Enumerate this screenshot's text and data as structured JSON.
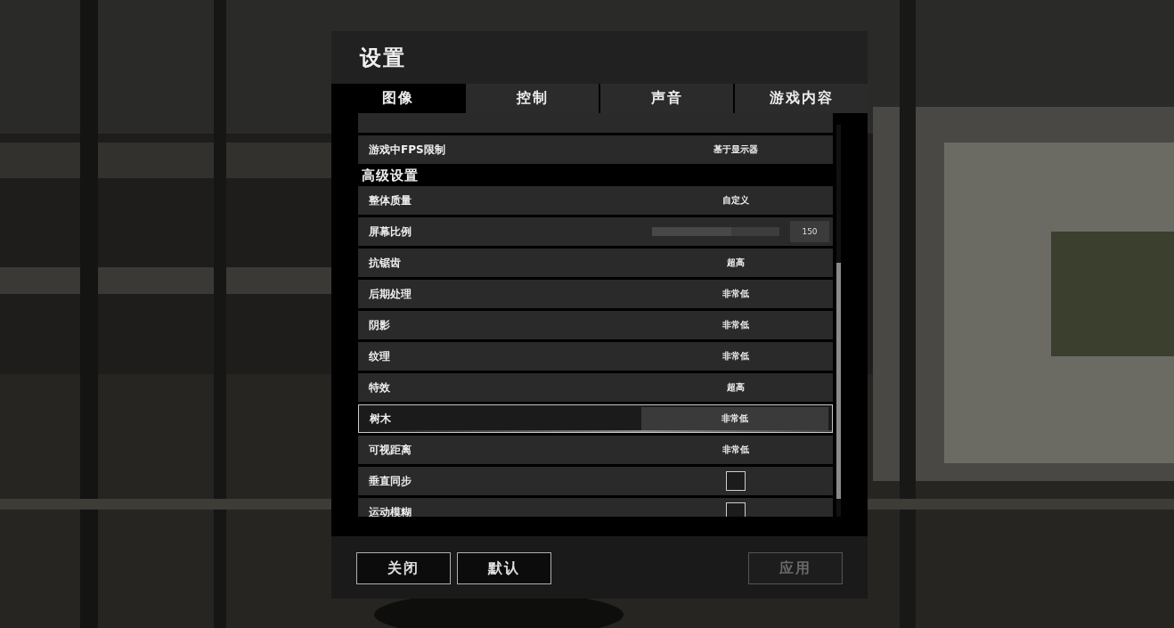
{
  "title": "设置",
  "tabs": [
    {
      "label": "图像",
      "selected": true
    },
    {
      "label": "控制",
      "selected": false
    },
    {
      "label": "声音",
      "selected": false
    },
    {
      "label": "游戏内容",
      "selected": false
    }
  ],
  "top_rows": [
    {
      "kind": "blank",
      "selected": false
    },
    {
      "kind": "value",
      "label": "游戏中FPS限制",
      "value": "基于显示器",
      "selected": false
    }
  ],
  "advanced": {
    "heading": "高级设置",
    "rows": [
      {
        "kind": "value",
        "label": "整体质量",
        "value": "自定义",
        "selected": false
      },
      {
        "kind": "slider",
        "label": "屏幕比例",
        "level": 0.62,
        "reading": "150",
        "selected": false
      },
      {
        "kind": "value",
        "label": "抗锯齿",
        "value": "超高",
        "selected": false
      },
      {
        "kind": "value",
        "label": "后期处理",
        "value": "非常低",
        "selected": false
      },
      {
        "kind": "value",
        "label": "阴影",
        "value": "非常低",
        "selected": false
      },
      {
        "kind": "value",
        "label": "纹理",
        "value": "非常低",
        "selected": false
      },
      {
        "kind": "value",
        "label": "特效",
        "value": "超高",
        "selected": false
      },
      {
        "kind": "value",
        "label": "树木",
        "value": "非常低",
        "selected": true
      },
      {
        "kind": "value",
        "label": "可视距离",
        "value": "非常低",
        "selected": false
      },
      {
        "kind": "checkbox",
        "label": "垂直同步",
        "checked": false,
        "selected": false
      },
      {
        "kind": "checkbox",
        "label": "运动模糊",
        "checked": false,
        "selected": false
      }
    ]
  },
  "footer": {
    "left_buttons": [
      {
        "label": "关闭",
        "disabled": false
      },
      {
        "label": "默认",
        "disabled": false
      }
    ],
    "right_buttons": [
      {
        "label": "应用",
        "disabled": true
      }
    ]
  }
}
